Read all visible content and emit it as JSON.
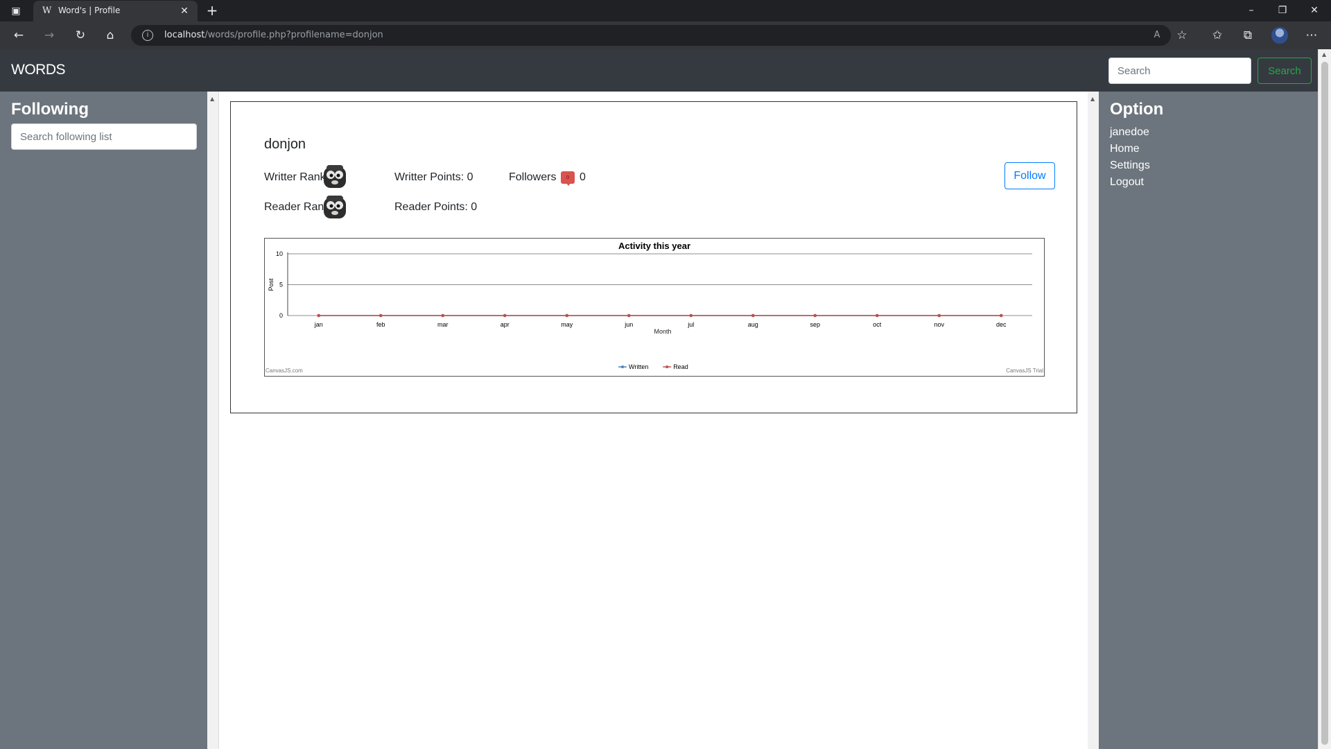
{
  "browser": {
    "tab_title": "Word's | Profile",
    "tab_favicon": "W",
    "url_host": "localhost",
    "url_path": "/words/profile.php?profilename=donjon"
  },
  "site": {
    "brand": "WORDS",
    "search_placeholder": "Search",
    "search_button": "Search"
  },
  "left_sidebar": {
    "title": "Following",
    "search_placeholder": "Search following list"
  },
  "right_sidebar": {
    "title": "Option",
    "items": [
      "janedoe",
      "Home",
      "Settings",
      "Logout"
    ]
  },
  "profile": {
    "name": "donjon",
    "writer_rank_label": "Writter Rank:",
    "reader_rank_label": "Reader Rank:",
    "writer_points": "Writter Points: 0",
    "reader_points": "Reader Points: 0",
    "followers_label": "Followers",
    "followers_badge": "0",
    "followers_count": "0",
    "follow_button": "Follow"
  },
  "colors": {
    "written": "#4f81bc",
    "read": "#c0504e",
    "navbar": "#343a40",
    "sidebar": "#6c757d",
    "follow_accent": "#007bff",
    "search_accent": "#28a745"
  },
  "chart_data": {
    "type": "line",
    "title": "Activity this year",
    "xlabel": "Month",
    "ylabel": "Post",
    "categories": [
      "jan",
      "feb",
      "mar",
      "apr",
      "may",
      "jun",
      "jul",
      "aug",
      "sep",
      "oct",
      "nov",
      "dec"
    ],
    "ylim": [
      0,
      10
    ],
    "yticks": [
      0,
      5,
      10
    ],
    "grid": true,
    "legend": "bottom-center",
    "series": [
      {
        "name": "Written",
        "values": [
          0,
          0,
          0,
          0,
          0,
          0,
          0,
          0,
          0,
          0,
          0,
          0
        ]
      },
      {
        "name": "Read",
        "values": [
          0,
          0,
          0,
          0,
          0,
          0,
          0,
          0,
          0,
          0,
          0,
          0
        ]
      }
    ],
    "credit_left": "CanvasJS.com",
    "credit_right": "CanvasJS Trial"
  }
}
